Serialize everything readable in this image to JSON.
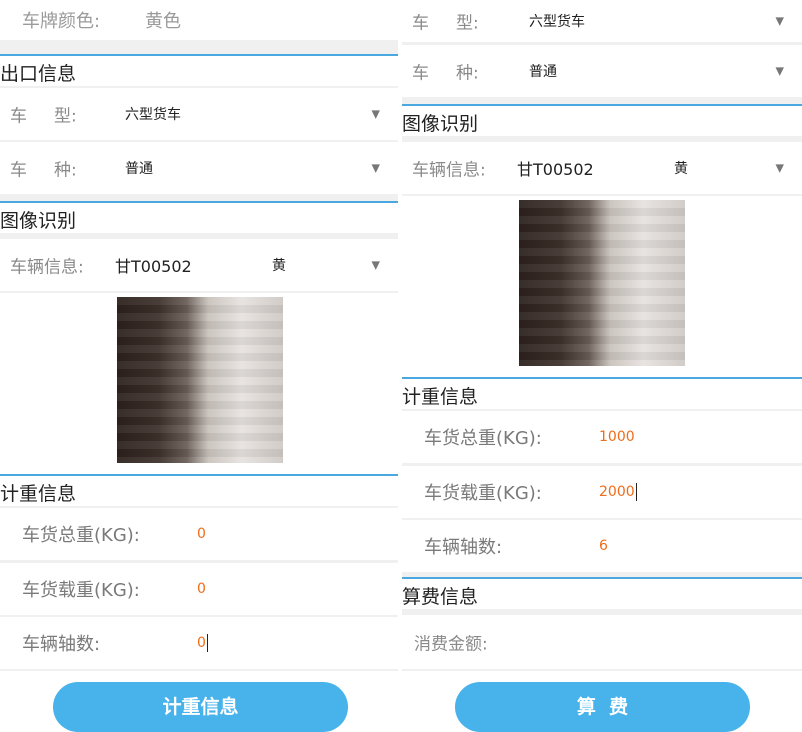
{
  "left": {
    "plate_color": {
      "label": "车牌颜色:",
      "value": "黄色"
    },
    "exit_section": {
      "title": "出口信息",
      "vehicle_type": {
        "label": "车     型:",
        "value": "六型货车"
      },
      "vehicle_kind": {
        "label": "车     种:",
        "value": "普通"
      }
    },
    "image_section": {
      "title": "图像识别",
      "vehicle_info": {
        "label": "车辆信息:",
        "plate": "甘T00502",
        "color": "黄"
      }
    },
    "weigh_section": {
      "title": "计重信息",
      "total_weight": {
        "label": "车货总重(KG):",
        "value": "0"
      },
      "load_weight": {
        "label": "车货载重(KG):",
        "value": "0"
      },
      "axle_count": {
        "label": "车辆轴数:",
        "value": "0"
      }
    },
    "button_label": "计重信息"
  },
  "right": {
    "vehicle_type": {
      "label": "车     型:",
      "value": "六型货车"
    },
    "vehicle_kind": {
      "label": "车     种:",
      "value": "普通"
    },
    "image_section": {
      "title": "图像识别",
      "vehicle_info": {
        "label": "车辆信息:",
        "plate": "甘T00502",
        "color": "黄"
      }
    },
    "weigh_section": {
      "title": "计重信息",
      "total_weight": {
        "label": "车货总重(KG):",
        "value": "1000"
      },
      "load_weight": {
        "label": "车货载重(KG):",
        "value": "2000"
      },
      "axle_count": {
        "label": "车辆轴数:",
        "value": "6"
      }
    },
    "fee_section": {
      "title": "算费信息",
      "fee_amount": {
        "label": "消费金额:",
        "value": ""
      }
    },
    "button_label": "算  费"
  },
  "icons": {
    "dropdown": "triangle-down-icon"
  },
  "colors": {
    "accent": "#4aa8e0",
    "button": "#47b3ea",
    "value_orange": "#ef6c1a"
  }
}
